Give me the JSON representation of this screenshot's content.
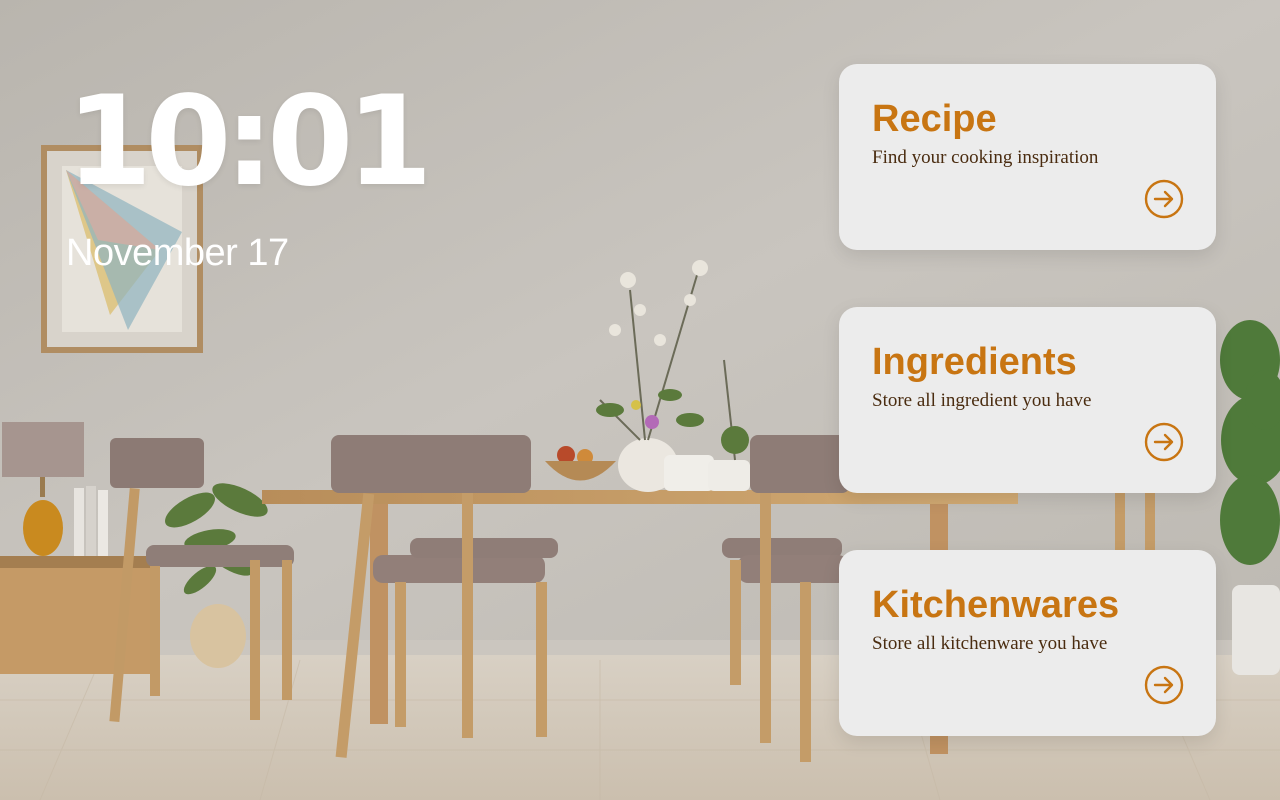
{
  "lock_screen": {
    "time": "10:01",
    "date": "November 17"
  },
  "cards": [
    {
      "title": "Recipe",
      "subtitle": "Find your cooking inspiration",
      "icon": "arrow-right-circle-icon"
    },
    {
      "title": "Ingredients",
      "subtitle": "Store all ingredient you have",
      "icon": "arrow-right-circle-icon"
    },
    {
      "title": "Kitchenwares",
      "subtitle": "Store all kitchenware you have",
      "icon": "arrow-right-circle-icon"
    }
  ],
  "colors": {
    "accent": "#c87512",
    "card_background": "#ececec",
    "subtitle_text": "#4a2c10",
    "clock_text": "#ffffff"
  }
}
